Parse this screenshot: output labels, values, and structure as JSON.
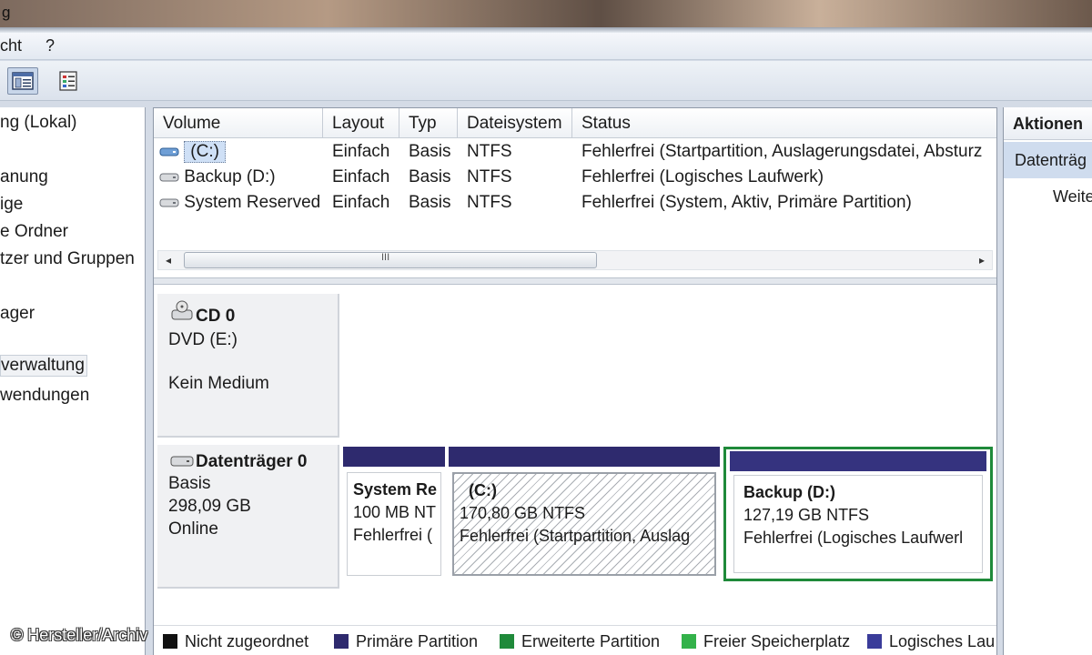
{
  "window": {
    "title_fragment": "g"
  },
  "menu": {
    "items": [
      "cht",
      "?"
    ]
  },
  "tree": {
    "items": [
      {
        "label": "ng (Lokal)"
      },
      {
        "label": "anung"
      },
      {
        "label": "ige"
      },
      {
        "label": "e Ordner"
      },
      {
        "label": "tzer und Gruppen"
      },
      {
        "label": "ager"
      },
      {
        "label": "verwaltung"
      },
      {
        "label": "wendungen"
      }
    ]
  },
  "volume_list": {
    "columns": [
      "Volume",
      "Layout",
      "Typ",
      "Dateisystem",
      "Status"
    ],
    "rows": [
      {
        "volume": "(C:)",
        "layout": "Einfach",
        "typ": "Basis",
        "fs": "NTFS",
        "status": "Fehlerfrei (Startpartition, Auslagerungsdatei, Absturz"
      },
      {
        "volume": "Backup (D:)",
        "layout": "Einfach",
        "typ": "Basis",
        "fs": "NTFS",
        "status": "Fehlerfrei (Logisches Laufwerk)"
      },
      {
        "volume": "System Reserved",
        "layout": "Einfach",
        "typ": "Basis",
        "fs": "NTFS",
        "status": "Fehlerfrei (System, Aktiv, Primäre Partition)"
      }
    ],
    "scroll_thumb_glyph": "III"
  },
  "disks": {
    "cd": {
      "name": "CD 0",
      "type": "DVD (E:)",
      "media": "Kein Medium"
    },
    "disk0": {
      "name": "Datenträger 0",
      "kind": "Basis",
      "size": "298,09 GB",
      "state": "Online",
      "partitions": [
        {
          "name": "System Re",
          "size": "100 MB NT",
          "status": "Fehlerfrei ("
        },
        {
          "name": "(C:)",
          "size": "170,80 GB NTFS",
          "status": "Fehlerfrei (Startpartition, Auslag"
        },
        {
          "name": "Backup  (D:)",
          "size": "127,19 GB NTFS",
          "status": "Fehlerfrei (Logisches Laufwerl"
        }
      ]
    }
  },
  "legend": [
    {
      "label": "Nicht zugeordnet",
      "color": "#111111"
    },
    {
      "label": "Primäre Partition",
      "color": "#2e2a6e"
    },
    {
      "label": "Erweiterte Partition",
      "color": "#1f8a3a"
    },
    {
      "label": "Freier Speicherplatz",
      "color": "#33b24a"
    },
    {
      "label": "Logisches Lau",
      "color": "#3a3c9a"
    }
  ],
  "actions": {
    "header": "Aktionen",
    "section": "Datenträg",
    "item": "Weite"
  },
  "credit": "© Hersteller/Archiv"
}
